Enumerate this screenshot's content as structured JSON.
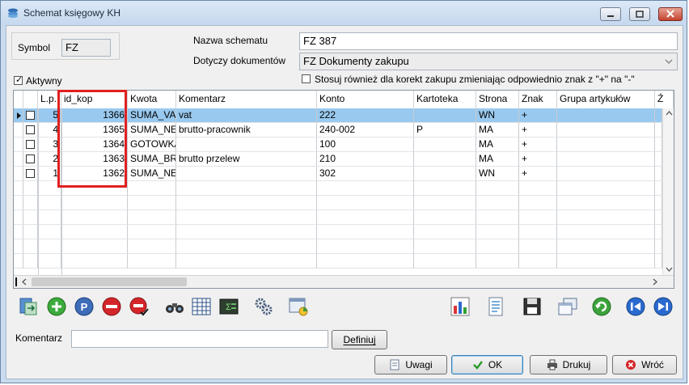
{
  "window": {
    "title": "Schemat księgowy KH"
  },
  "form": {
    "symbol_label": "Symbol",
    "symbol_value": "FZ",
    "name_label": "Nazwa schematu",
    "name_value": "FZ 387",
    "docs_label": "Dotyczy dokumentów",
    "docs_value": "FZ Dokumenty zakupu",
    "active_label": "Aktywny",
    "active_checked": true,
    "correction_label": "Stosuj również dla korekt zakupu zmieniając odpowiednio znak z \"+\" na \"-\"",
    "correction_checked": false
  },
  "grid": {
    "columns": [
      "L.p.",
      "id_kop",
      "Kwota",
      "Komentarz",
      "Konto",
      "Kartoteka",
      "Strona",
      "Znak",
      "Grupa artykułów",
      "Ź"
    ],
    "rows": [
      {
        "lp": "5",
        "id_kop": "1366",
        "kwota": "SUMA_VAT",
        "komentarz": "vat",
        "konto": "222",
        "kartoteka": "",
        "strona": "WN",
        "znak": "+",
        "selected": true
      },
      {
        "lp": "4",
        "id_kop": "1365",
        "kwota": "SUMA_NETTO",
        "komentarz": "brutto-pracownik",
        "konto": "240-002",
        "kartoteka": "P",
        "strona": "MA",
        "znak": "+",
        "selected": false
      },
      {
        "lp": "3",
        "id_kop": "1364",
        "kwota": "GOTOWKA",
        "komentarz": "",
        "konto": "100",
        "kartoteka": "",
        "strona": "MA",
        "znak": "+",
        "selected": false
      },
      {
        "lp": "2",
        "id_kop": "1363",
        "kwota": "SUMA_BRUTTO",
        "komentarz": "brutto przelew",
        "konto": "210",
        "kartoteka": "",
        "strona": "MA",
        "znak": "+",
        "selected": false
      },
      {
        "lp": "1",
        "id_kop": "1362",
        "kwota": "SUMA_NETTO",
        "komentarz": "",
        "konto": "302",
        "kartoteka": "",
        "strona": "WN",
        "znak": "+",
        "selected": false
      }
    ]
  },
  "toolbar": {
    "icons": [
      "export-icon",
      "add-icon",
      "edit-icon",
      "delete-icon",
      "delete-confirm-icon",
      "binoculars-icon",
      "table-filter-icon",
      "sum-icon",
      "gears-icon",
      "window-chart-icon",
      "chart-icon",
      "report-icon",
      "save-icon",
      "windows-icon",
      "refresh-icon",
      "first-icon",
      "next-icon"
    ]
  },
  "bottom": {
    "comment_label": "Komentarz",
    "comment_value": "",
    "define_label": "Definiuj",
    "notes_label": "Uwagi",
    "ok_label": "OK",
    "print_label": "Drukuj",
    "back_label": "Wróć"
  },
  "colors": {
    "selection": "#99c9ef",
    "highlight_box": "#e02020",
    "window_frame": "#c9dbee"
  }
}
